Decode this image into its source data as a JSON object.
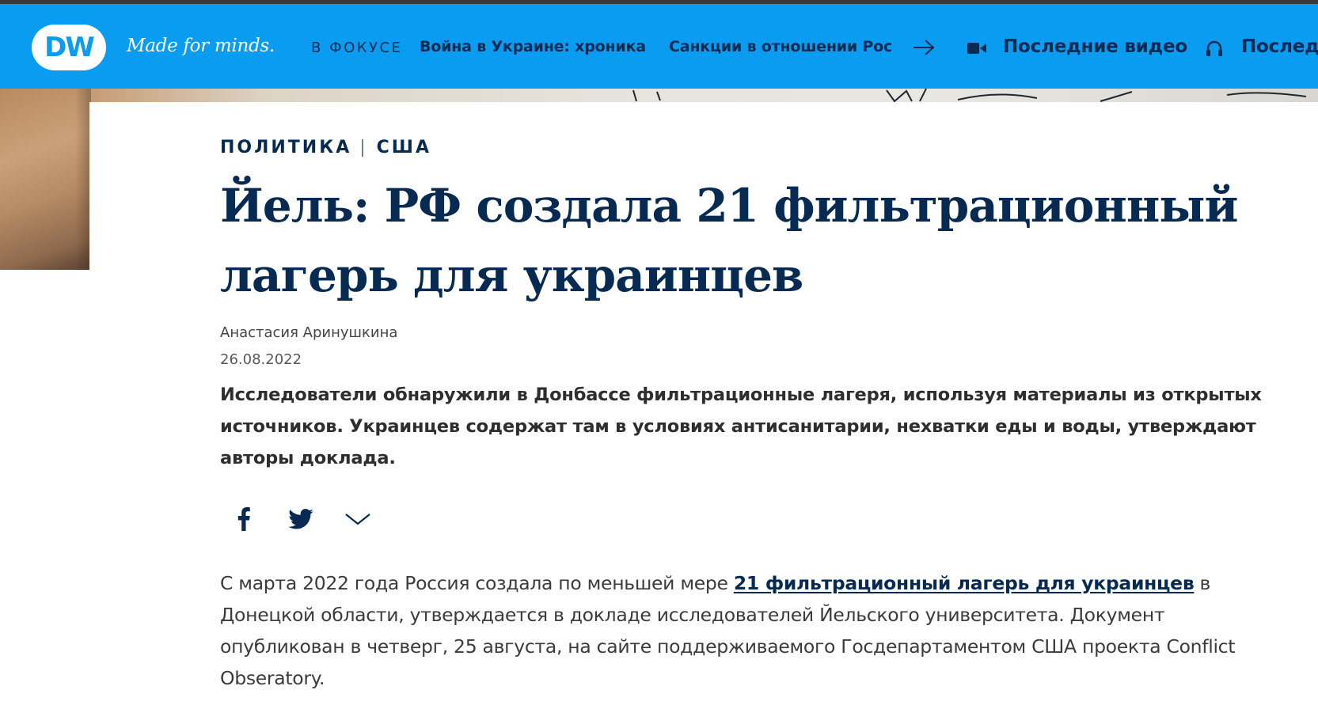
{
  "header": {
    "logo_text": "DW",
    "tagline": "Made for minds.",
    "focus_label": "В ФОКУСЕ",
    "links": [
      {
        "label": "Война в Украине: хроника"
      },
      {
        "label": "Санкции в отношении Рос"
      }
    ],
    "latest_video_label": "Последние видео",
    "latest_audio_label": "Последн",
    "colors": {
      "background": "#0a9cf0",
      "text": "#062a52"
    }
  },
  "article": {
    "kicker": {
      "category": "ПОЛИТИКА",
      "separator": "|",
      "subcategory": "США"
    },
    "title": "Йель: РФ создала 21 фильтрационный лагерь для украинцев",
    "author": "Анастасия Аринушкина",
    "date": "26.08.2022",
    "teaser": "Исследователи обнаружили в Донбассе фильтрационные лагеря, используя материалы из открытых источников. Украинцев содержат там в условиях антисанитарии, нехватки еды и воды, утверждают авторы доклада.",
    "share": {
      "icons": [
        "facebook-icon",
        "twitter-icon",
        "chevron-down-icon"
      ]
    },
    "body": {
      "before_link": "С марта 2022 года Россия создала по меньшей мере ",
      "link_text": "21 фильтрационный лагерь для украинцев",
      "after_link": " в Донецкой области, утверждается в докладе исследователей Йельского университета. Документ опубликован в четверг, 25 августа, на сайте поддерживаемого Госдепартаментом США проекта Conflict Obseratory."
    },
    "colors": {
      "title": "#062a52",
      "teaser": "#2e2e2e",
      "body": "#3b3b3b"
    }
  }
}
